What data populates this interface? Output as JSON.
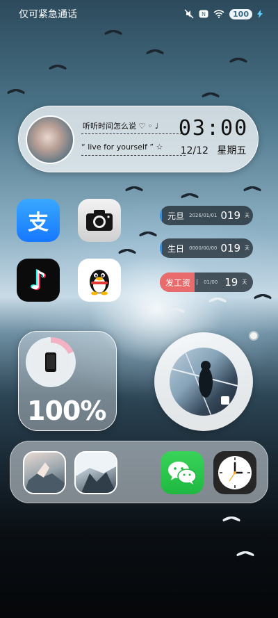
{
  "status_bar": {
    "left_text": "仅可紧急通话",
    "icons": [
      "mute-icon",
      "nfc-icon",
      "wifi-icon",
      "battery-icon",
      "charging-icon"
    ],
    "battery_level": "100"
  },
  "music_widget": {
    "song_line": "听听时间怎么说 ♡ ◦ ♩",
    "quote_line": "“ live for yourself ” ☆",
    "time": "03:00",
    "date": "12/12  星期五"
  },
  "apps": [
    {
      "name": "alipay",
      "icon": "alipay-icon",
      "glyph": "支"
    },
    {
      "name": "camera",
      "icon": "camera-icon"
    },
    {
      "name": "tiktok",
      "icon": "tiktok-icon",
      "glyph": "♪"
    },
    {
      "name": "qq",
      "icon": "qq-penguin-icon"
    }
  ],
  "countdowns": [
    {
      "label": "元旦",
      "date": "2026/01/01",
      "days": "019",
      "unit": "天",
      "color": "#3a8fd9"
    },
    {
      "label": "生日",
      "date": "0000/00/00",
      "days": "019",
      "unit": "天",
      "color": "#3a8fd9"
    },
    {
      "label": "发工资",
      "date": "01/00",
      "days": "19",
      "unit": "天",
      "color": "#e96b6b"
    }
  ],
  "battery_widget": {
    "percent_text": "100%",
    "ring_fill": 0.18,
    "ring_color": "#f3b2c4",
    "icon": "phone-icon"
  },
  "photo_widget": {
    "icon": "photo-icon"
  },
  "dock": {
    "apps": [
      {
        "name": "photo-app-1",
        "icon": "photo-thumbnail"
      },
      {
        "name": "photo-app-2",
        "icon": "photo-thumbnail"
      },
      {
        "name": "wechat",
        "icon": "wechat-icon"
      },
      {
        "name": "clock",
        "icon": "clock-icon"
      }
    ]
  }
}
